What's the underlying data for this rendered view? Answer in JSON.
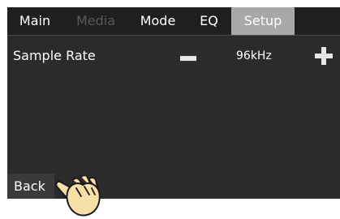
{
  "tabs": [
    {
      "label": "Main",
      "state": "normal"
    },
    {
      "label": "Media",
      "state": "disabled"
    },
    {
      "label": "Mode",
      "state": "normal"
    },
    {
      "label": "EQ",
      "state": "normal"
    },
    {
      "label": "Setup",
      "state": "active"
    }
  ],
  "setup": {
    "sample_rate_label": "Sample Rate",
    "sample_rate_value": "96kHz",
    "minus_icon": "minus-icon",
    "plus_icon": "plus-icon"
  },
  "footer": {
    "back_label": "Back"
  },
  "colors": {
    "screen_bg": "#2b2b2b",
    "tabbar_bg": "#1f1f1f",
    "active_tab_bg": "#a8a8a8",
    "disabled_text": "#5a5a5a",
    "hand_fill": "#f7dfa8"
  }
}
